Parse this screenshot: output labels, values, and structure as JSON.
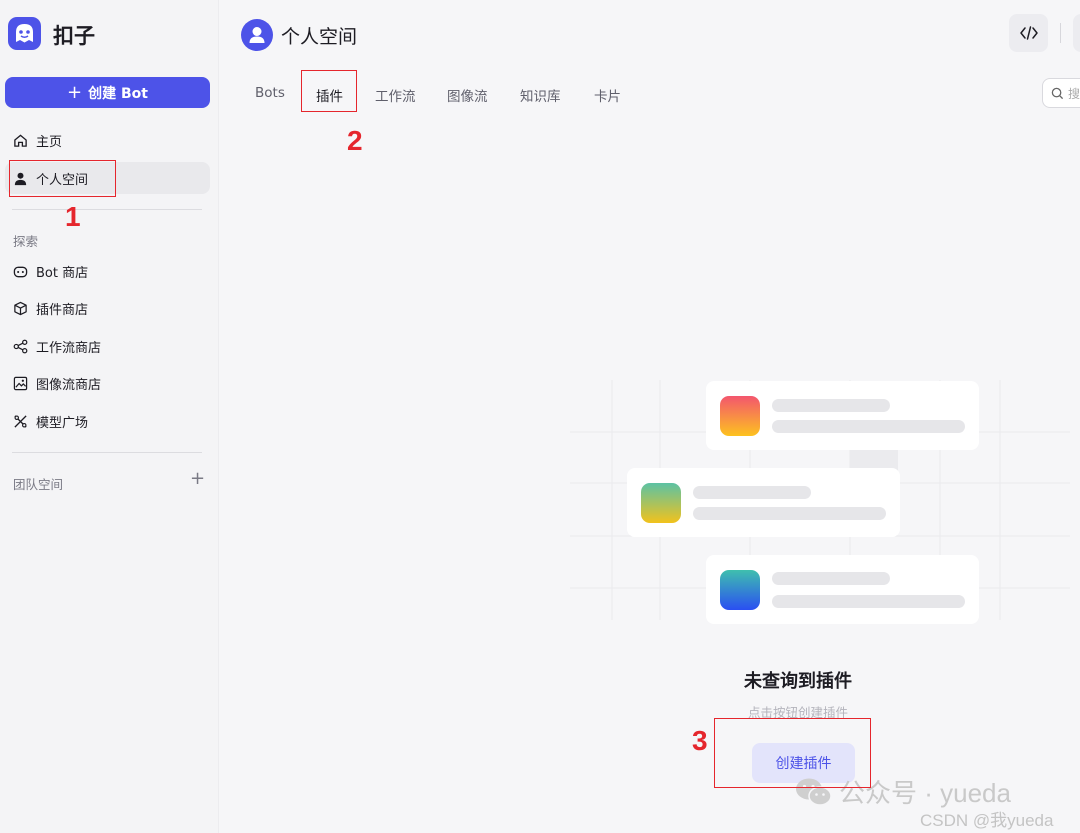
{
  "app": {
    "brand": "扣子"
  },
  "sidebar": {
    "create_button": "创建 Bot",
    "home": "主页",
    "personal_space": "个人空间",
    "explore_title": "探索",
    "explore_items": [
      "Bot 商店",
      "插件商店",
      "工作流商店",
      "图像流商店",
      "模型广场"
    ],
    "team_title": "团队空间"
  },
  "header": {
    "title": "个人空间"
  },
  "tabs": [
    "Bots",
    "插件",
    "工作流",
    "图像流",
    "知识库",
    "卡片"
  ],
  "active_tab": "插件",
  "search": {
    "placeholder": "搜"
  },
  "empty_state": {
    "title": "未查询到插件",
    "subtitle": "点击按钮创建插件",
    "button": "创建插件"
  },
  "annotations": [
    "1",
    "2",
    "3"
  ],
  "watermark": {
    "line1": "公众号 · yueda",
    "line2": "CSDN @我yueda"
  },
  "colors": {
    "accent": "#4d53e8",
    "annotation": "#e5262d"
  }
}
